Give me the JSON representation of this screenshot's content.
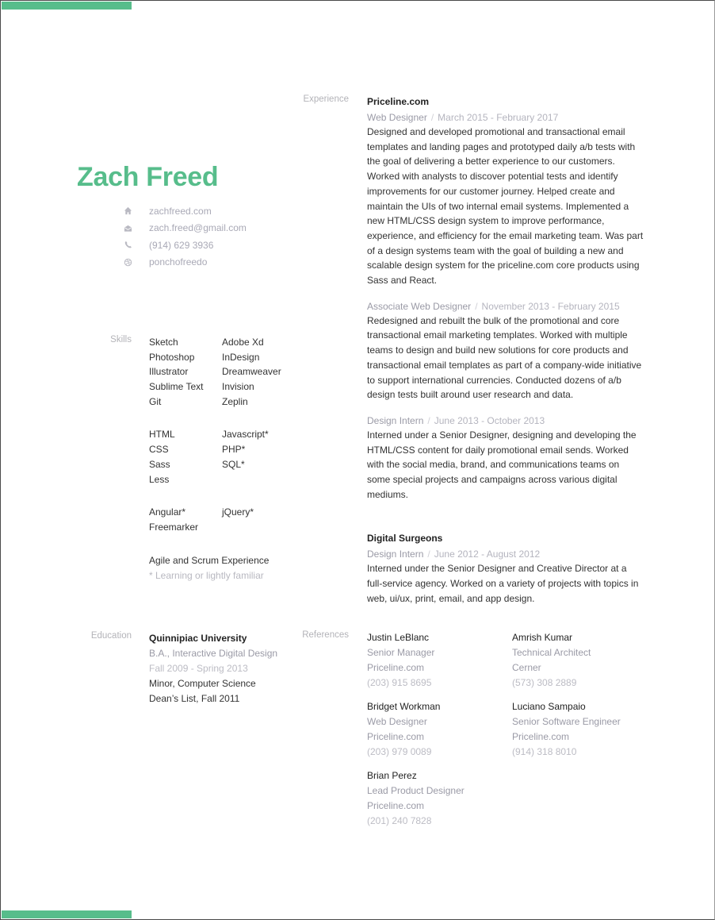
{
  "theme": {
    "accent": "#57bd8b",
    "border": "#4a4a4a"
  },
  "header": {
    "name": "Zach Freed",
    "contacts": [
      {
        "icon": "home-icon",
        "text": "zachfreed.com"
      },
      {
        "icon": "envelope-icon",
        "text": "zach.freed@gmail.com"
      },
      {
        "icon": "phone-icon",
        "text": "(914) 629 3936"
      },
      {
        "icon": "dribbble-icon",
        "text": "ponchofreedo"
      }
    ]
  },
  "experience": {
    "label": "Experience",
    "companies": [
      {
        "name": "Priceline.com",
        "jobs": [
          {
            "title": "Web Designer",
            "separator": "/",
            "dates": "March 2015 - February 2017",
            "description": "Designed and developed promotional and transactional email templates and landing pages and prototyped daily a/b tests with the goal of delivering a better experience to our customers. Worked with analysts to discover potential tests and identify improvements for our customer journey. Helped create and maintain the UIs of two internal email systems. Implemented a new HTML/CSS design system to improve performance, experience, and efficiency for the email marketing team. Was part of a design systems team with the goal of building a new and scalable design system for the priceline.com core products using Sass and React."
          },
          {
            "title": "Associate Web Designer",
            "separator": "/",
            "dates": "November 2013 - February 2015",
            "description": "Redesigned and rebuilt the bulk of the promotional and core transactional email marketing templates. Worked with multiple teams to design and build new solutions for core products and transactional email templates as part of a company-wide initiative to support international currencies. Conducted dozens of a/b design tests built around user research and data."
          },
          {
            "title": "Design Intern",
            "separator": "/",
            "dates": "June 2013 - October 2013",
            "description": "Interned under a Senior Designer, designing and developing the HTML/CSS content for daily promotional email sends. Worked with the social media, brand, and communications teams on some special projects and campaigns across various digital mediums."
          }
        ]
      },
      {
        "name": "Digital Surgeons",
        "jobs": [
          {
            "title": "Design Intern",
            "separator": "/",
            "dates": "June 2012 - August 2012",
            "description": "Interned under the Senior Designer and Creative Director at a full-service agency. Worked on a variety of projects with topics in web, ui/ux, print, email, and app design."
          }
        ]
      }
    ]
  },
  "skills": {
    "label": "Skills",
    "groups": [
      [
        "Sketch",
        "Adobe Xd",
        "Photoshop",
        "InDesign",
        "Illustrator",
        "Dreamweaver",
        "Sublime Text",
        "Invision",
        "Git",
        "Zeplin"
      ],
      [
        "HTML",
        "Javascript*",
        "CSS",
        "PHP*",
        "Sass",
        "SQL*",
        "Less",
        ""
      ],
      [
        "Angular*",
        "jQuery*",
        "Freemarker",
        ""
      ]
    ],
    "extra": "Agile and Scrum Experience",
    "note": "* Learning or lightly familiar"
  },
  "education": {
    "label": "Education",
    "school": "Quinnipiac University",
    "degree": "B.A., Interactive Digital Design",
    "years": "Fall 2009 - Spring 2013",
    "minor": "Minor, Computer Science",
    "honors": "Dean’s List, Fall 2011"
  },
  "references": {
    "label": "References",
    "items": [
      {
        "name": "Justin LeBlanc",
        "title": "Senior Manager",
        "company": "Priceline.com",
        "phone": "(203) 915 8695"
      },
      {
        "name": "Amrish Kumar",
        "title": "Technical Architect",
        "company": "Cerner",
        "phone": "(573) 308 2889"
      },
      {
        "name": "Bridget Workman",
        "title": "Web Designer",
        "company": "Priceline.com",
        "phone": "(203) 979 0089"
      },
      {
        "name": "Luciano Sampaio",
        "title": "Senior Software Engineer",
        "company": "Priceline.com",
        "phone": "(914) 318 8010"
      },
      {
        "name": "Brian Perez",
        "title": "Lead Product Designer",
        "company": "Priceline.com",
        "phone": "(201) 240 7828"
      }
    ]
  }
}
